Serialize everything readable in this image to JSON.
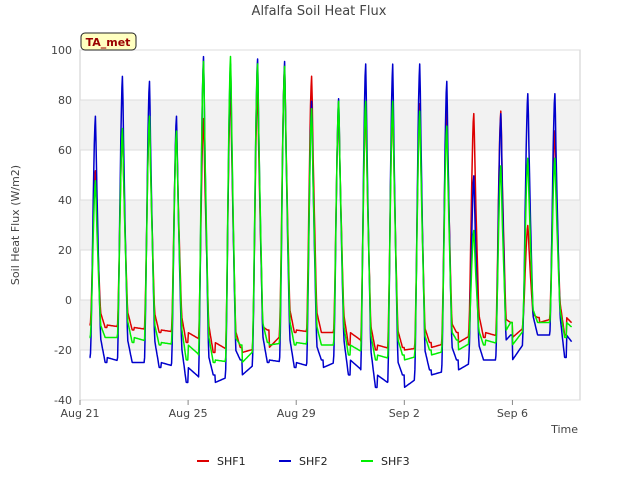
{
  "chart_data": {
    "type": "line",
    "title": "Alfalfa Soil Heat Flux",
    "xlabel": "Time",
    "ylabel": "Soil Heat Flux (W/m2)",
    "badge": "TA_met",
    "ylim": [
      -40,
      100
    ],
    "yticks": [
      -40,
      -20,
      0,
      20,
      40,
      60,
      80,
      100
    ],
    "xlim": [
      "2023-08-21",
      "2023-09-08 12:00"
    ],
    "xtick_labels": [
      {
        "label": "Aug 21",
        "date": "2023-08-21"
      },
      {
        "label": "Aug 25",
        "date": "2023-08-25"
      },
      {
        "label": "Aug 29",
        "date": "2023-08-29"
      },
      {
        "label": "Sep 2",
        "date": "2023-09-02"
      },
      {
        "label": "Sep 6",
        "date": "2023-09-06"
      }
    ],
    "grid": true,
    "legend_position": "bottom",
    "series": [
      {
        "name": "SHF1",
        "color": "#dd0000",
        "daily_min": [
          -10,
          -11,
          -12,
          -13,
          -17,
          -21,
          -19,
          -12,
          -13,
          -13,
          -18,
          -20,
          -19,
          -17,
          -13,
          -15,
          -9,
          -7,
          -14
        ],
        "daily_max": [
          52,
          68,
          73,
          69,
          73,
          85,
          85,
          94,
          90,
          77,
          77,
          79,
          79,
          78,
          75,
          76,
          30,
          68,
          72
        ]
      },
      {
        "name": "SHF2",
        "color": "#0000cc",
        "daily_min": [
          -23,
          -25,
          -25,
          -27,
          -33,
          -30,
          -24,
          -25,
          -27,
          -24,
          -30,
          -35,
          -30,
          -28,
          -24,
          -24,
          -14,
          -14,
          -23
        ],
        "daily_max": [
          74,
          90,
          88,
          74,
          98,
          95,
          97,
          96,
          80,
          81,
          95,
          95,
          95,
          88,
          50,
          75,
          83,
          83,
          83
        ]
      },
      {
        "name": "SHF3",
        "color": "#00ee00",
        "daily_min": [
          -15,
          -15,
          -17,
          -18,
          -24,
          -25,
          -18,
          -17,
          -18,
          -18,
          -22,
          -24,
          -22,
          -20,
          -16,
          -18,
          -9,
          -9,
          -15
        ],
        "daily_max": [
          48,
          69,
          74,
          68,
          96,
          98,
          95,
          94,
          77,
          80,
          80,
          80,
          76,
          70,
          28,
          54,
          57,
          57,
          57
        ]
      }
    ]
  }
}
